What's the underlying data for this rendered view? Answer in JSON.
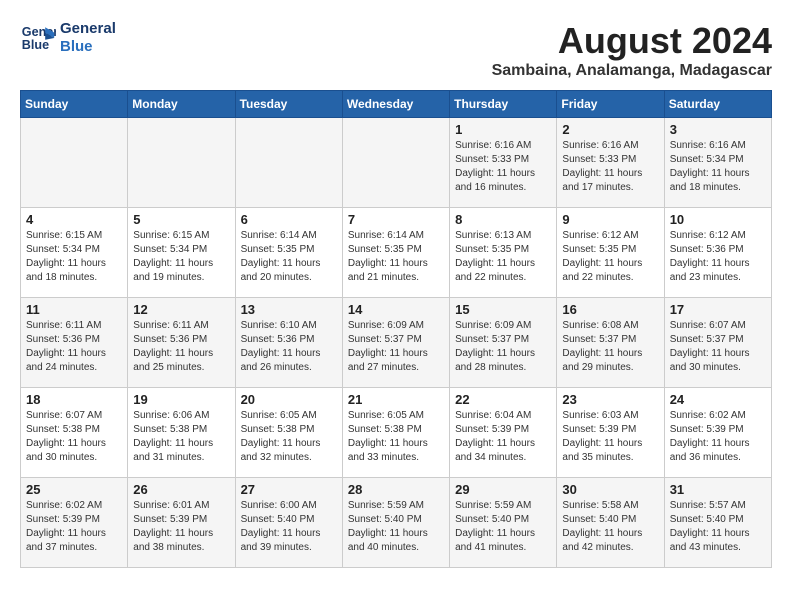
{
  "logo": {
    "line1": "General",
    "line2": "Blue"
  },
  "title": {
    "month_year": "August 2024",
    "location": "Sambaina, Analamanga, Madagascar"
  },
  "days_of_week": [
    "Sunday",
    "Monday",
    "Tuesday",
    "Wednesday",
    "Thursday",
    "Friday",
    "Saturday"
  ],
  "weeks": [
    [
      {
        "day": "",
        "info": ""
      },
      {
        "day": "",
        "info": ""
      },
      {
        "day": "",
        "info": ""
      },
      {
        "day": "",
        "info": ""
      },
      {
        "day": "1",
        "info": "Sunrise: 6:16 AM\nSunset: 5:33 PM\nDaylight: 11 hours\nand 16 minutes."
      },
      {
        "day": "2",
        "info": "Sunrise: 6:16 AM\nSunset: 5:33 PM\nDaylight: 11 hours\nand 17 minutes."
      },
      {
        "day": "3",
        "info": "Sunrise: 6:16 AM\nSunset: 5:34 PM\nDaylight: 11 hours\nand 18 minutes."
      }
    ],
    [
      {
        "day": "4",
        "info": "Sunrise: 6:15 AM\nSunset: 5:34 PM\nDaylight: 11 hours\nand 18 minutes."
      },
      {
        "day": "5",
        "info": "Sunrise: 6:15 AM\nSunset: 5:34 PM\nDaylight: 11 hours\nand 19 minutes."
      },
      {
        "day": "6",
        "info": "Sunrise: 6:14 AM\nSunset: 5:35 PM\nDaylight: 11 hours\nand 20 minutes."
      },
      {
        "day": "7",
        "info": "Sunrise: 6:14 AM\nSunset: 5:35 PM\nDaylight: 11 hours\nand 21 minutes."
      },
      {
        "day": "8",
        "info": "Sunrise: 6:13 AM\nSunset: 5:35 PM\nDaylight: 11 hours\nand 22 minutes."
      },
      {
        "day": "9",
        "info": "Sunrise: 6:12 AM\nSunset: 5:35 PM\nDaylight: 11 hours\nand 22 minutes."
      },
      {
        "day": "10",
        "info": "Sunrise: 6:12 AM\nSunset: 5:36 PM\nDaylight: 11 hours\nand 23 minutes."
      }
    ],
    [
      {
        "day": "11",
        "info": "Sunrise: 6:11 AM\nSunset: 5:36 PM\nDaylight: 11 hours\nand 24 minutes."
      },
      {
        "day": "12",
        "info": "Sunrise: 6:11 AM\nSunset: 5:36 PM\nDaylight: 11 hours\nand 25 minutes."
      },
      {
        "day": "13",
        "info": "Sunrise: 6:10 AM\nSunset: 5:36 PM\nDaylight: 11 hours\nand 26 minutes."
      },
      {
        "day": "14",
        "info": "Sunrise: 6:09 AM\nSunset: 5:37 PM\nDaylight: 11 hours\nand 27 minutes."
      },
      {
        "day": "15",
        "info": "Sunrise: 6:09 AM\nSunset: 5:37 PM\nDaylight: 11 hours\nand 28 minutes."
      },
      {
        "day": "16",
        "info": "Sunrise: 6:08 AM\nSunset: 5:37 PM\nDaylight: 11 hours\nand 29 minutes."
      },
      {
        "day": "17",
        "info": "Sunrise: 6:07 AM\nSunset: 5:37 PM\nDaylight: 11 hours\nand 30 minutes."
      }
    ],
    [
      {
        "day": "18",
        "info": "Sunrise: 6:07 AM\nSunset: 5:38 PM\nDaylight: 11 hours\nand 30 minutes."
      },
      {
        "day": "19",
        "info": "Sunrise: 6:06 AM\nSunset: 5:38 PM\nDaylight: 11 hours\nand 31 minutes."
      },
      {
        "day": "20",
        "info": "Sunrise: 6:05 AM\nSunset: 5:38 PM\nDaylight: 11 hours\nand 32 minutes."
      },
      {
        "day": "21",
        "info": "Sunrise: 6:05 AM\nSunset: 5:38 PM\nDaylight: 11 hours\nand 33 minutes."
      },
      {
        "day": "22",
        "info": "Sunrise: 6:04 AM\nSunset: 5:39 PM\nDaylight: 11 hours\nand 34 minutes."
      },
      {
        "day": "23",
        "info": "Sunrise: 6:03 AM\nSunset: 5:39 PM\nDaylight: 11 hours\nand 35 minutes."
      },
      {
        "day": "24",
        "info": "Sunrise: 6:02 AM\nSunset: 5:39 PM\nDaylight: 11 hours\nand 36 minutes."
      }
    ],
    [
      {
        "day": "25",
        "info": "Sunrise: 6:02 AM\nSunset: 5:39 PM\nDaylight: 11 hours\nand 37 minutes."
      },
      {
        "day": "26",
        "info": "Sunrise: 6:01 AM\nSunset: 5:39 PM\nDaylight: 11 hours\nand 38 minutes."
      },
      {
        "day": "27",
        "info": "Sunrise: 6:00 AM\nSunset: 5:40 PM\nDaylight: 11 hours\nand 39 minutes."
      },
      {
        "day": "28",
        "info": "Sunrise: 5:59 AM\nSunset: 5:40 PM\nDaylight: 11 hours\nand 40 minutes."
      },
      {
        "day": "29",
        "info": "Sunrise: 5:59 AM\nSunset: 5:40 PM\nDaylight: 11 hours\nand 41 minutes."
      },
      {
        "day": "30",
        "info": "Sunrise: 5:58 AM\nSunset: 5:40 PM\nDaylight: 11 hours\nand 42 minutes."
      },
      {
        "day": "31",
        "info": "Sunrise: 5:57 AM\nSunset: 5:40 PM\nDaylight: 11 hours\nand 43 minutes."
      }
    ]
  ]
}
